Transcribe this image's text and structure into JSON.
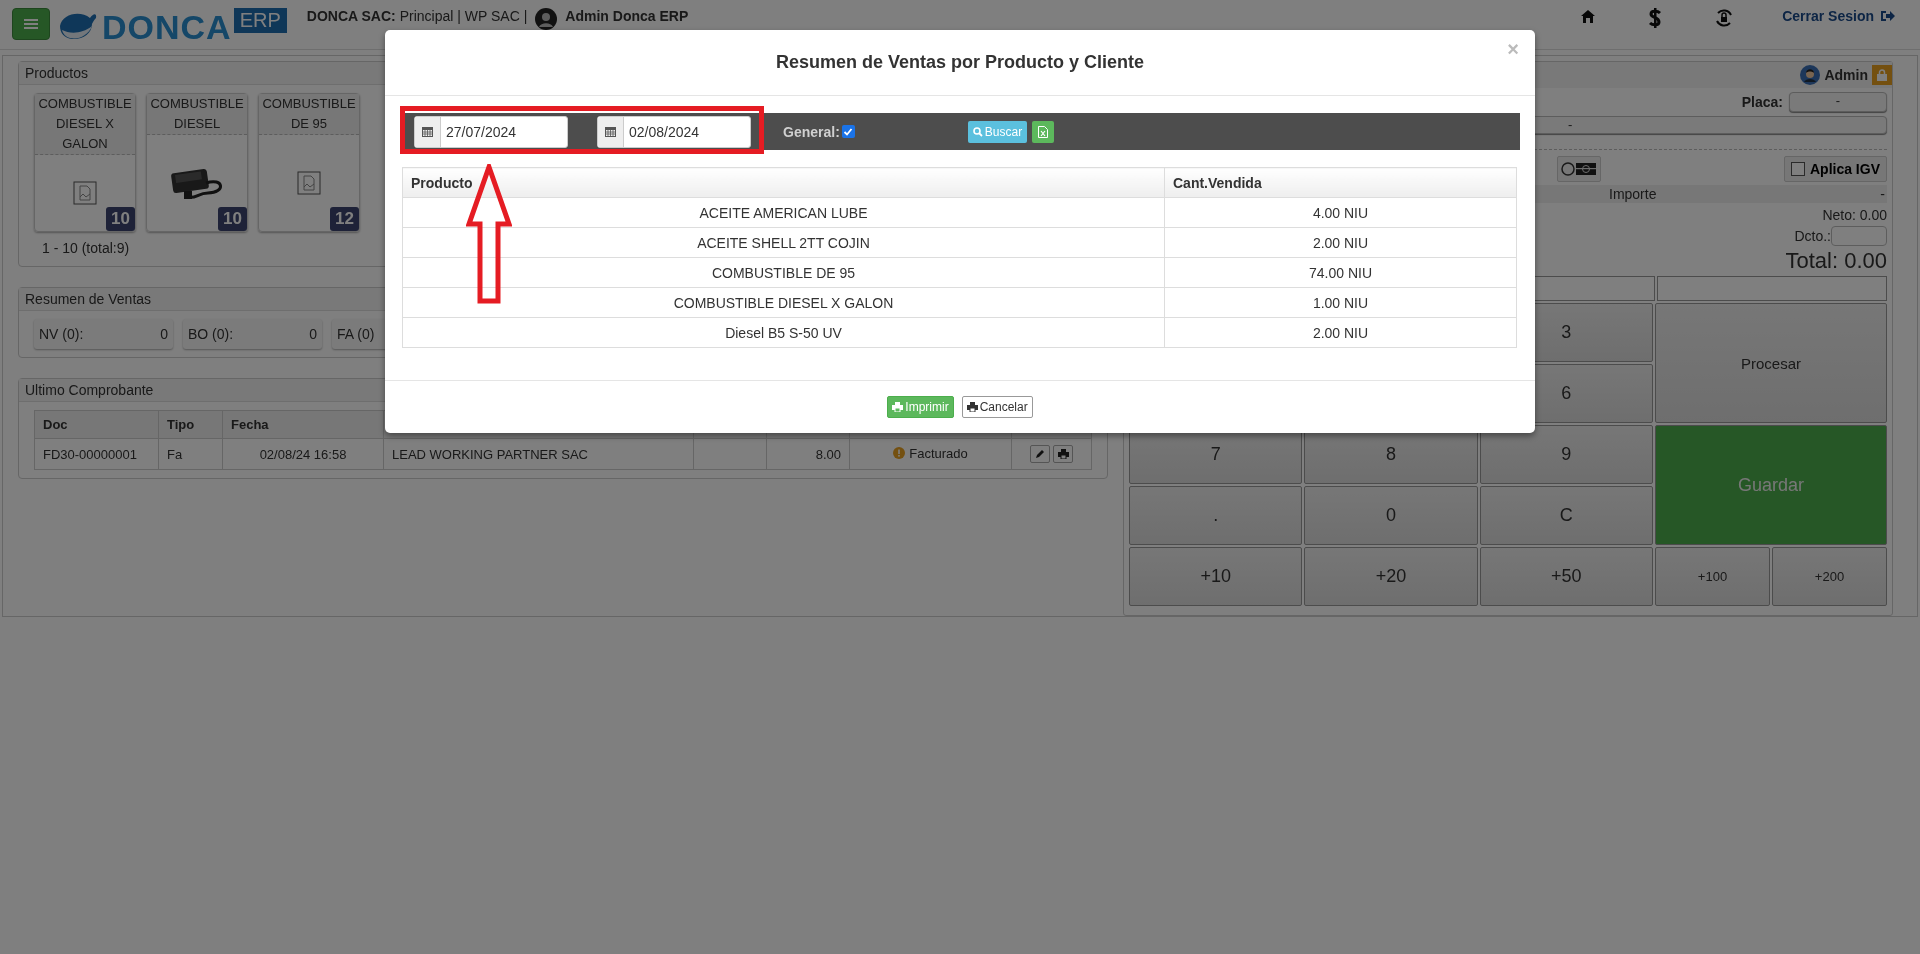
{
  "header": {
    "brand": "DONCA",
    "brand_tag": "ERP",
    "company_label": "DONCA SAC:",
    "company_info": "Principal | WP SAC |",
    "user": "Admin Donca ERP",
    "logout": "Cerrar Sesion"
  },
  "products": {
    "title": "Productos",
    "items": [
      {
        "name": "COMBUSTIBLE DIESEL X GALON",
        "stock": "10",
        "kind": "placeholder"
      },
      {
        "name": "COMBUSTIBLE DIESEL",
        "stock": "10"
      },
      {
        "name": "COMBUSTIBLE DE 95",
        "stock": "12",
        "kind": "placeholder"
      }
    ],
    "pagination": "1 - 10 (total:9)"
  },
  "sales_summary": {
    "title": "Resumen de Ventas",
    "items": [
      {
        "label": "NV (0):",
        "value": "0"
      },
      {
        "label": "BO (0):",
        "value": "0"
      },
      {
        "label": "FA (0)"
      }
    ]
  },
  "last_receipt": {
    "title": "Ultimo Comprobante",
    "columns": [
      "Doc",
      "Tipo",
      "Fecha"
    ],
    "rows": [
      {
        "doc": "FD30-00000001",
        "type": "Fa",
        "date": "02/08/24 16:58",
        "client": "LEAD WORKING PARTNER SAC",
        "amount": "8.00",
        "status": "Facturado"
      }
    ]
  },
  "pos": {
    "user": "Admin",
    "plate_label": "Placa:",
    "plate_value": "-",
    "client_value": "-",
    "igv_label": "Aplica IGV",
    "igv_checked": false,
    "amount_label": "Importe",
    "amount_value": "-",
    "net": "Neto: 0.00",
    "discount_label": "Dcto.:",
    "total": "Total: 0.00",
    "keypad_rows": [
      [
        "3"
      ],
      [
        "6"
      ],
      [
        "7",
        "8",
        "9"
      ],
      [
        ".",
        "0",
        "C"
      ],
      [
        "+10",
        "+20",
        "+50"
      ]
    ],
    "process": "Procesar",
    "save": "Guardar",
    "quick": [
      "+100",
      "+200"
    ]
  },
  "modal": {
    "title": "Resumen de Ventas por Producto y Cliente",
    "close": "×",
    "date_from": "27/07/2024",
    "date_to": "02/08/2024",
    "general_label": "General:",
    "general_checked": true,
    "search": "Buscar",
    "columns": [
      "Producto",
      "Cant.Vendida"
    ],
    "rows": [
      {
        "product": "ACEITE AMERICAN LUBE",
        "quantity": "4.00 NIU"
      },
      {
        "product": "ACEITE SHELL 2TT COJIN",
        "quantity": "2.00 NIU"
      },
      {
        "product": "COMBUSTIBLE DE 95",
        "quantity": "74.00 NIU"
      },
      {
        "product": "COMBUSTIBLE DIESEL X GALON",
        "quantity": "1.00 NIU"
      },
      {
        "product": "Diesel B5 S-50 UV",
        "quantity": "2.00 NIU"
      }
    ],
    "print": "Imprimir",
    "cancel": "Cancelar"
  }
}
